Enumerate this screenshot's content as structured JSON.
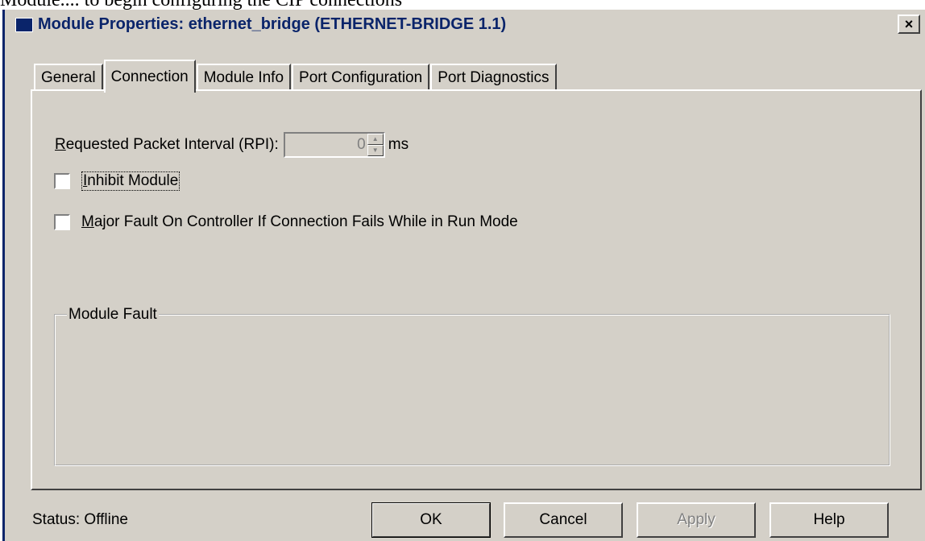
{
  "background_text": "Module.... to begin configuring the CIP connections",
  "window": {
    "title": "Module Properties: ethernet_bridge (ETHERNET-BRIDGE 1.1)",
    "close_label": "×"
  },
  "tabs": [
    {
      "label": "General",
      "active": false
    },
    {
      "label": "Connection",
      "active": true
    },
    {
      "label": "Module Info",
      "active": false
    },
    {
      "label": "Port Configuration",
      "active": false
    },
    {
      "label": "Port Diagnostics",
      "active": false
    }
  ],
  "connection": {
    "rpi_label_first": "R",
    "rpi_label_rest": "equested Packet Interval (RPI):",
    "rpi_value": "0",
    "rpi_unit": "ms",
    "inhibit_first": "I",
    "inhibit_rest": "nhibit Module",
    "inhibit_checked": false,
    "major_fault_first": "M",
    "major_fault_rest": "ajor Fault On Controller If Connection Fails While in Run Mode",
    "major_fault_checked": false
  },
  "module_fault": {
    "label": "Module Fault"
  },
  "status": {
    "text": "Status:  Offline"
  },
  "buttons": {
    "ok": "OK",
    "cancel": "Cancel",
    "apply": "Apply",
    "help": "Help"
  },
  "colors": {
    "dialog_bg": "#d4d0c8",
    "title_text": "#0a246a"
  }
}
